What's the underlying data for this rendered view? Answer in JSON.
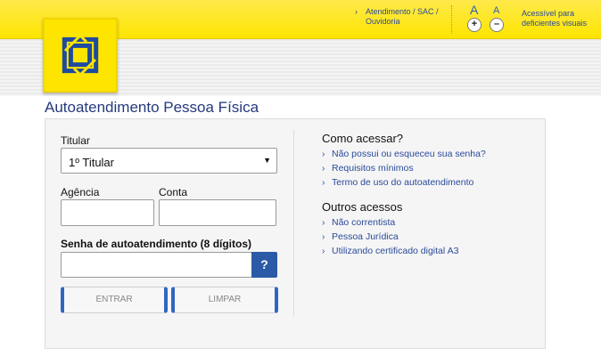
{
  "header": {
    "top_link_label": "Atendimento / SAC / Ouvidoria",
    "font_increase_glyph": "A",
    "font_decrease_glyph": "A",
    "plus_label": "+",
    "minus_label": "–",
    "accessibility_text": "Acessível para deficientes visuais",
    "chevron_glyph": "›"
  },
  "colors": {
    "brand_yellow": "#fde500",
    "brand_blue": "#25397e",
    "link_blue": "#2a4a9a",
    "button_accent": "#2f66c2"
  },
  "icons": {
    "logo": "banco-do-brasil-logo-icon",
    "chevron": "chevron-right-icon",
    "dropdown": "caret-down-icon"
  },
  "page": {
    "title": "Autoatendimento Pessoa Física"
  },
  "form": {
    "titular_label": "Titular",
    "titular_value": "1º Titular",
    "agencia_label": "Agência",
    "conta_label": "Conta",
    "senha_label": "Senha de autoatendimento (8 dígitos)",
    "help_label": "?",
    "enter_label": "ENTRAR",
    "clear_label": "LIMPAR",
    "dropdown_arrow": "▼"
  },
  "sidebar": {
    "how_title": "Como acessar?",
    "how_links": [
      "Não possui ou esqueceu sua senha?",
      "Requisitos mínimos",
      "Termo de uso do autoatendimento"
    ],
    "other_title": "Outros acessos",
    "other_links": [
      "Não correntista",
      "Pessoa Jurídica",
      "Utilizando certificado digital A3"
    ]
  }
}
